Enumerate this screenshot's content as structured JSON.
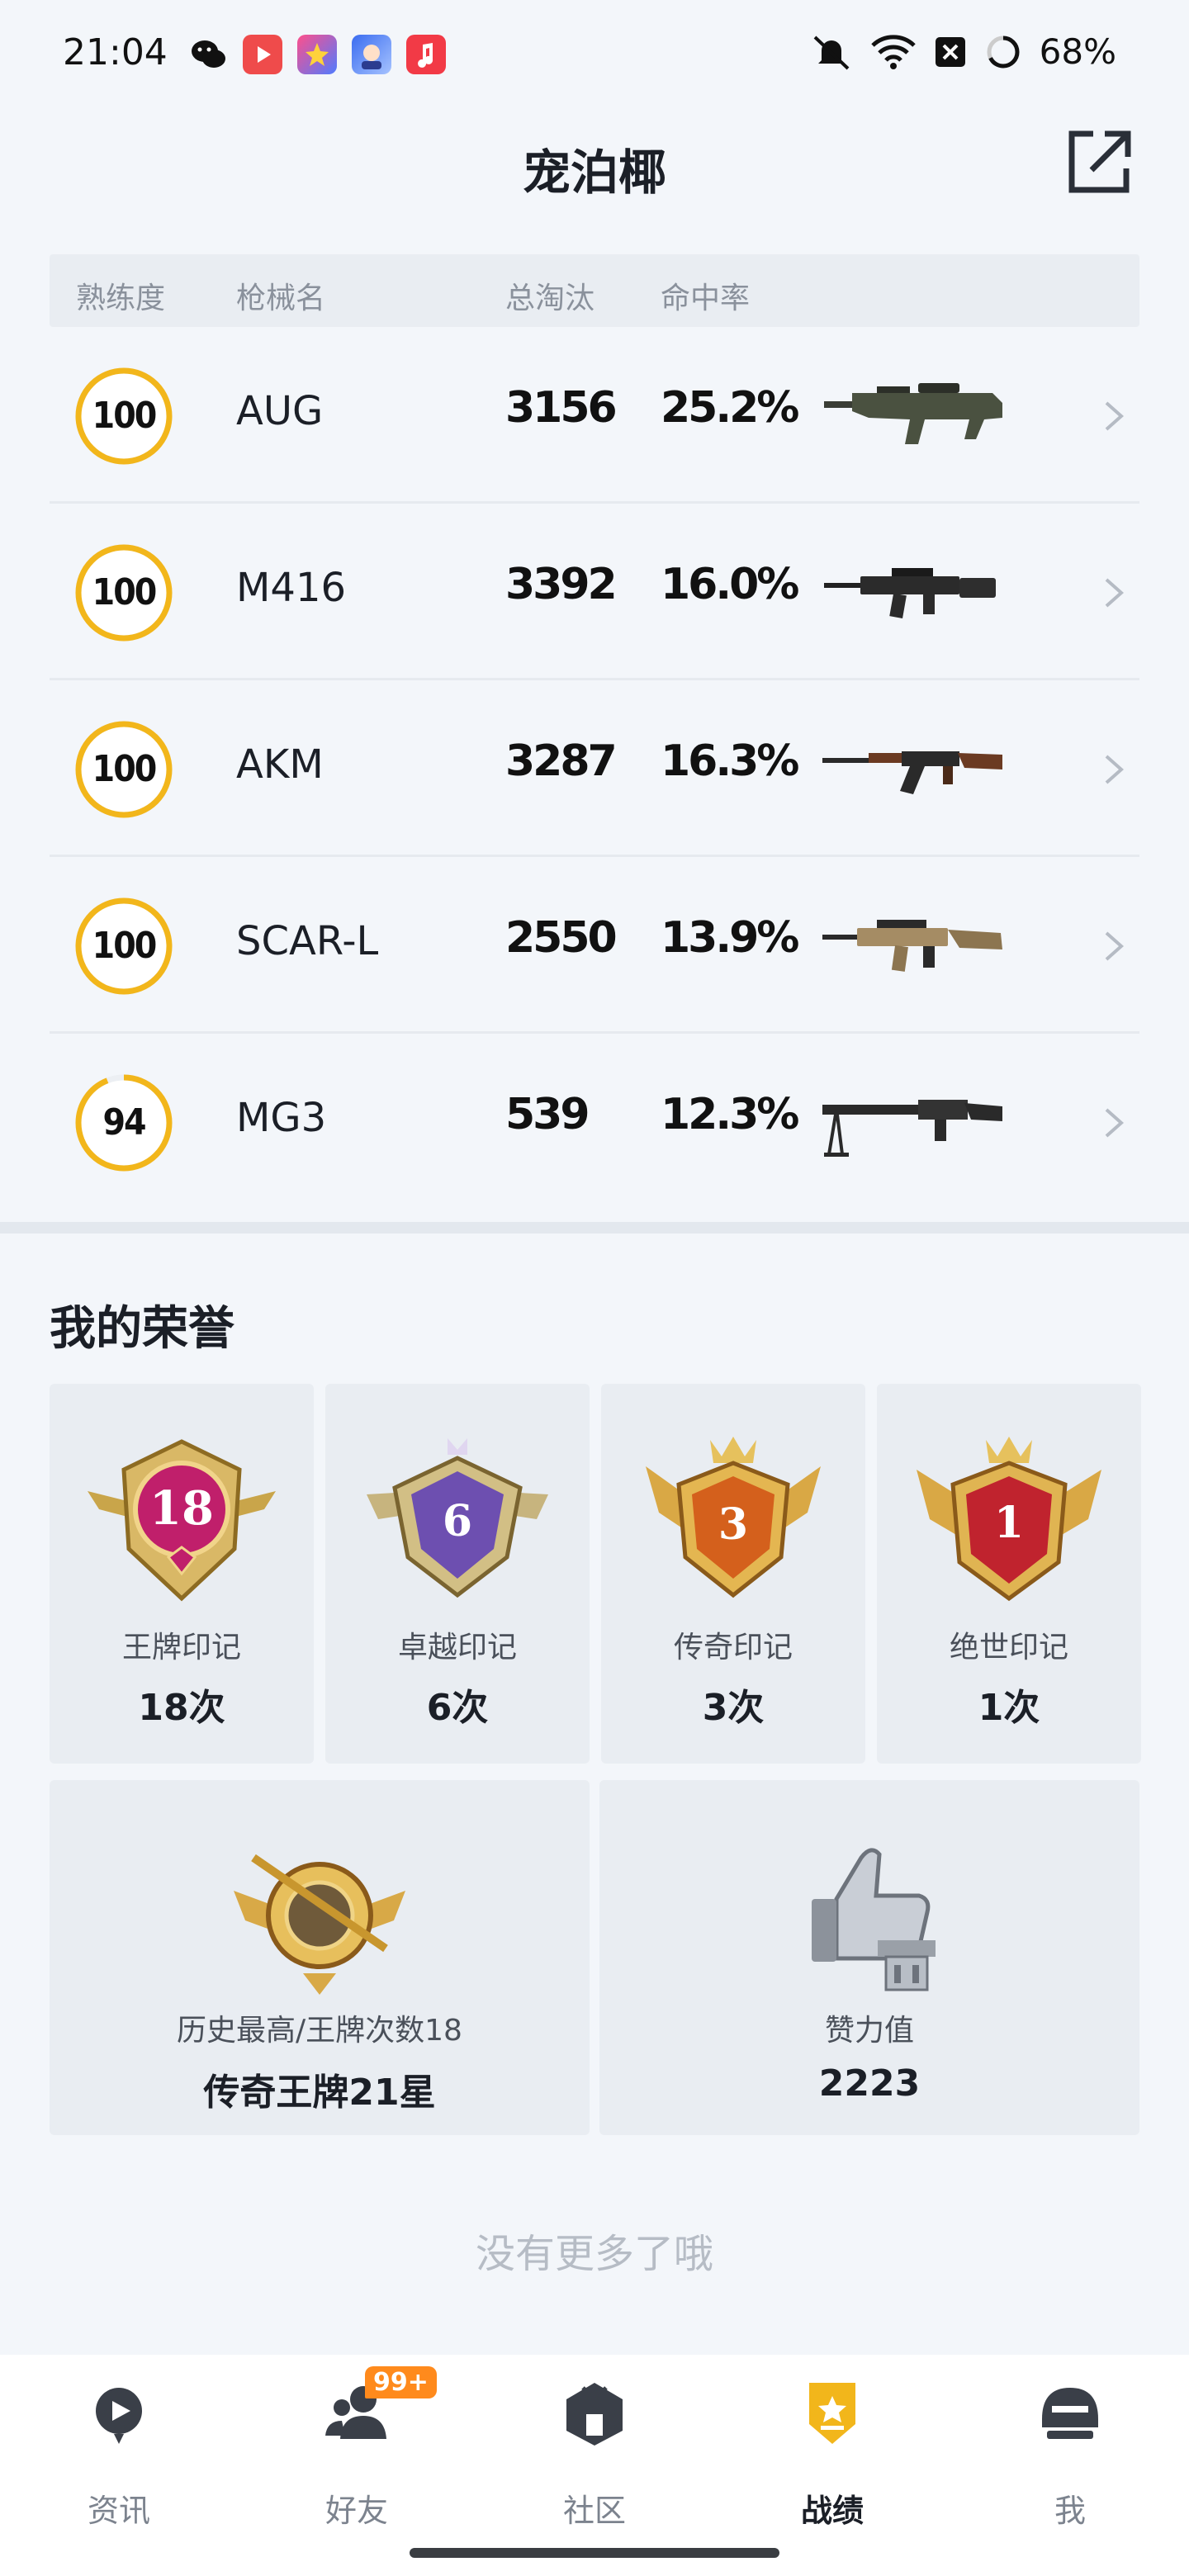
{
  "status_bar": {
    "time": "21:04",
    "battery": "68%",
    "app_icons": [
      "wechat-icon",
      "video-app-icon",
      "star-app-icon",
      "game-app-icon",
      "music-app-icon"
    ]
  },
  "header": {
    "title": "宠泊椰",
    "share_icon": "external-link-icon"
  },
  "weapon_table": {
    "columns": [
      "熟练度",
      "枪械名",
      "总淘汰",
      "命中率"
    ],
    "rows": [
      {
        "proficiency": "100",
        "proficiency_pct": 1.0,
        "name": "AUG",
        "kills": "3156",
        "hit_rate": "25.2%",
        "image": "aug-rifle-image"
      },
      {
        "proficiency": "100",
        "proficiency_pct": 1.0,
        "name": "M416",
        "kills": "3392",
        "hit_rate": "16.0%",
        "image": "m416-rifle-image"
      },
      {
        "proficiency": "100",
        "proficiency_pct": 1.0,
        "name": "AKM",
        "kills": "3287",
        "hit_rate": "16.3%",
        "image": "akm-rifle-image"
      },
      {
        "proficiency": "100",
        "proficiency_pct": 1.0,
        "name": "SCAR-L",
        "kills": "2550",
        "hit_rate": "13.9%",
        "image": "scarl-rifle-image"
      },
      {
        "proficiency": "94",
        "proficiency_pct": 0.94,
        "name": "MG3",
        "kills": "539",
        "hit_rate": "12.3%",
        "image": "mg3-machinegun-image"
      }
    ]
  },
  "honors": {
    "title": "我的荣誉",
    "cards": [
      {
        "badge_number": "18",
        "label": "王牌印记",
        "count": "18次",
        "color": "#c01f6b"
      },
      {
        "badge_number": "6",
        "label": "卓越印记",
        "count": "6次",
        "color": "#6d4fb0"
      },
      {
        "badge_number": "3",
        "label": "传奇印记",
        "count": "3次",
        "color": "#d4601c"
      },
      {
        "badge_number": "1",
        "label": "绝世印记",
        "count": "1次",
        "color": "#c0232e"
      }
    ],
    "history": {
      "label": "历史最高/王牌次数18",
      "value": "传奇王牌21星"
    },
    "likes": {
      "label": "赞力值",
      "value": "2223"
    }
  },
  "footer_text": "没有更多了哦",
  "bottom_nav": {
    "items": [
      {
        "label": "资讯",
        "icon": "news-icon",
        "active": false
      },
      {
        "label": "好友",
        "icon": "friends-icon",
        "badge": "99+",
        "active": false
      },
      {
        "label": "社区",
        "icon": "community-icon",
        "active": false
      },
      {
        "label": "战绩",
        "icon": "record-icon",
        "active": true
      },
      {
        "label": "我",
        "icon": "profile-helmet-icon",
        "active": false
      }
    ]
  },
  "colors": {
    "accent_gold": "#f2b61b",
    "background": "#f3f6fa",
    "badge_orange": "#ff8a1c"
  }
}
